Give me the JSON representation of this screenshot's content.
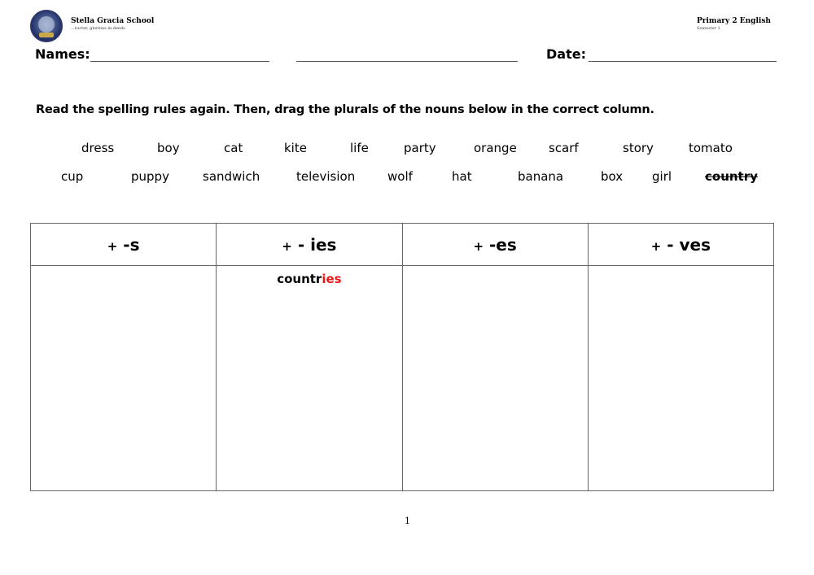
{
  "header": {
    "school_name": "Stella Gracia School",
    "motto": "...ructer, glorious in deeds",
    "subject": "Primary 2 English",
    "semester": "Semester 1"
  },
  "fields": {
    "names_label": "Names:",
    "date_label": "Date:"
  },
  "instructions": "Read the spelling rules again. Then, drag the plurals of the nouns below in the correct column.",
  "word_bank": {
    "row1": [
      "dress",
      "boy",
      "cat",
      "kite",
      "life",
      "party",
      "orange",
      "scarf",
      "story",
      "tomato"
    ],
    "row2": [
      "cup",
      "puppy",
      "sandwich",
      "television",
      "wolf",
      "hat",
      "banana",
      "box",
      "girl",
      "country"
    ],
    "used_words": [
      "country"
    ]
  },
  "columns": [
    {
      "plus": "+",
      "suffix": "-s",
      "items": []
    },
    {
      "plus": "+",
      "suffix": "- ies",
      "items": [
        {
          "stem": "countr",
          "suffix": "ies"
        }
      ]
    },
    {
      "plus": "+",
      "suffix": "-es",
      "items": []
    },
    {
      "plus": "+",
      "suffix": "- ves",
      "items": []
    }
  ],
  "colors": {
    "suffix_highlight": "#e8191b"
  },
  "page_number": "1"
}
